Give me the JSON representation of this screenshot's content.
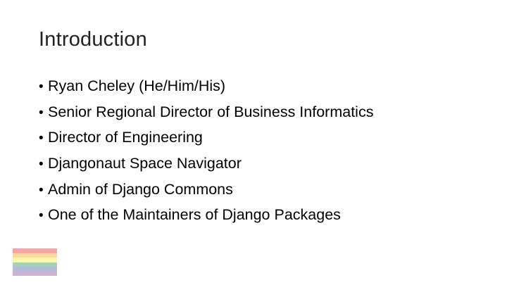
{
  "slide": {
    "title": "Introduction",
    "bullets": [
      "Ryan Cheley (He/Him/His)",
      "Senior Regional Director of Business Informatics",
      "Director of Engineering",
      "Djangonaut Space Navigator",
      "Admin of Django Commons",
      "One of the Maintainers of Django Packages"
    ],
    "bullet_glyph": "•"
  },
  "flag": {
    "icon": "rainbow-flag-icon",
    "stripe_colors": [
      "#e40303",
      "#ff8c00",
      "#ffed00",
      "#008026",
      "#24408e",
      "#732982"
    ]
  }
}
